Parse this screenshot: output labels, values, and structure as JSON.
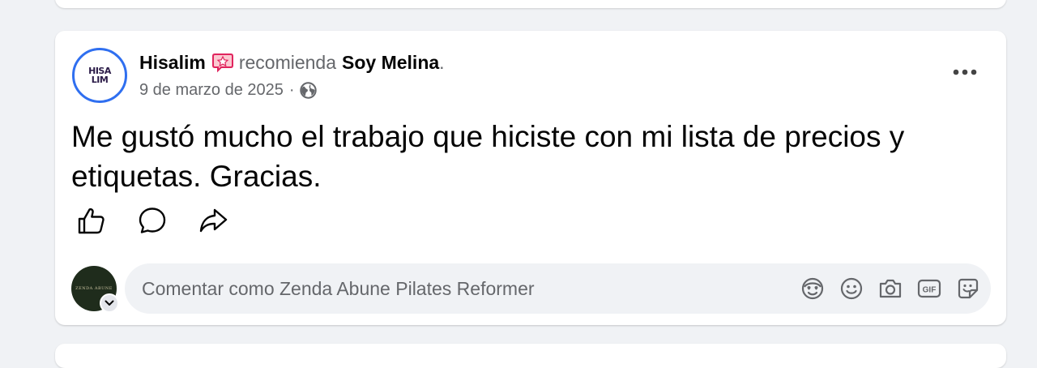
{
  "post": {
    "author": "Hisalim",
    "author_avatar_text": "HISA LIM",
    "verb": "recomienda",
    "target": "Soy Melina",
    "period": ".",
    "date": "9 de marzo de 2025",
    "separator": "·",
    "audience_icon": "globe-icon",
    "recommend_icon": "star-badge-icon",
    "body": "Me gustó mucho el trabajo que hiciste con mi lista de precios y etiquetas. Gracias."
  },
  "actions": {
    "like_icon": "thumbs-up-icon",
    "comment_icon": "comment-bubble-icon",
    "share_icon": "share-arrow-icon"
  },
  "comment": {
    "avatar_text": "ZENDA ABUNE",
    "placeholder": "Comentar como Zenda Abune Pilates Reformer",
    "tools": [
      "avatar-sticker-icon",
      "emoji-icon",
      "camera-icon",
      "gif-icon",
      "sticker-icon"
    ]
  },
  "colors": {
    "background": "#f0f2f5",
    "card": "#ffffff",
    "secondary_text": "#65676b",
    "recommend_badge": "#f02849",
    "avatar_ring": "#2f6ff0"
  }
}
